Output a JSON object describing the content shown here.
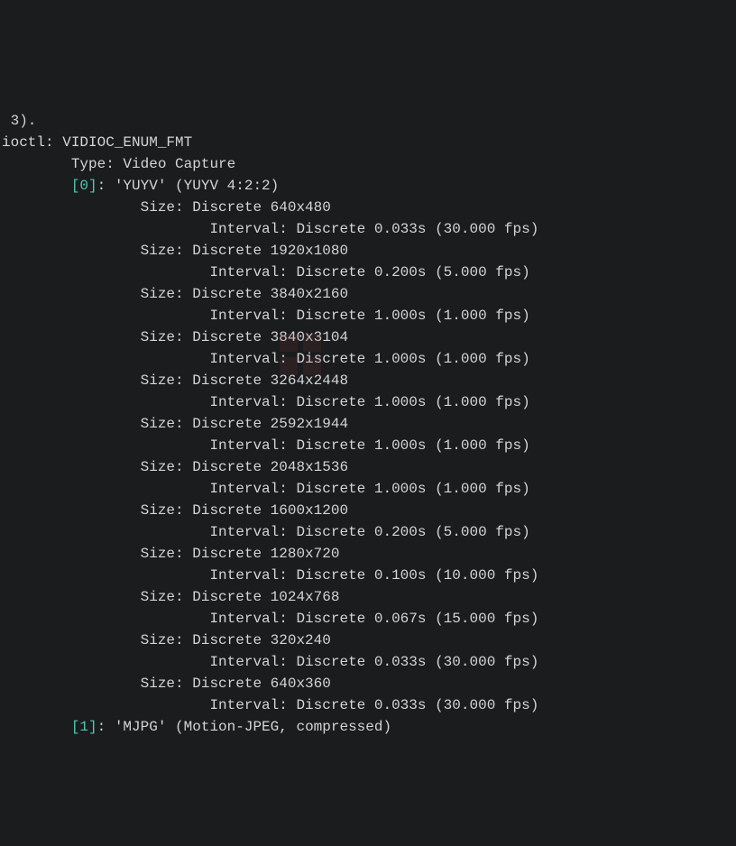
{
  "lines": [
    {
      "indent": 0,
      "segments": [
        {
          "text": " 3).",
          "cls": "white"
        }
      ]
    },
    {
      "indent": 0,
      "segments": [
        {
          "text": "ioctl: VIDIOC_ENUM_FMT",
          "cls": "white"
        }
      ]
    },
    {
      "indent": 8,
      "segments": [
        {
          "text": "Type: Video Capture",
          "cls": "white"
        }
      ]
    },
    {
      "indent": 0,
      "segments": [
        {
          "text": "",
          "cls": "white"
        }
      ]
    },
    {
      "indent": 8,
      "segments": [
        {
          "text": "[0]",
          "cls": "cyan"
        },
        {
          "text": ": 'YUYV' (YUYV 4:2:2)",
          "cls": "white"
        }
      ]
    },
    {
      "indent": 16,
      "segments": [
        {
          "text": "Size: Discrete 640x480",
          "cls": "white"
        }
      ]
    },
    {
      "indent": 24,
      "segments": [
        {
          "text": "Interval: Discrete 0.033s (30.000 fps)",
          "cls": "white"
        }
      ]
    },
    {
      "indent": 16,
      "segments": [
        {
          "text": "Size: Discrete 1920x1080",
          "cls": "white"
        }
      ]
    },
    {
      "indent": 24,
      "segments": [
        {
          "text": "Interval: Discrete 0.200s (5.000 fps)",
          "cls": "white"
        }
      ]
    },
    {
      "indent": 16,
      "segments": [
        {
          "text": "Size: Discrete 3840x2160",
          "cls": "white"
        }
      ]
    },
    {
      "indent": 24,
      "segments": [
        {
          "text": "Interval: Discrete 1.000s (1.000 fps)",
          "cls": "white"
        }
      ]
    },
    {
      "indent": 16,
      "segments": [
        {
          "text": "Size: Discrete 3840x3104",
          "cls": "white"
        }
      ]
    },
    {
      "indent": 24,
      "segments": [
        {
          "text": "Interval: Discrete 1.000s (1.000 fps)",
          "cls": "white"
        }
      ]
    },
    {
      "indent": 16,
      "segments": [
        {
          "text": "Size: Discrete 3264x2448",
          "cls": "white"
        }
      ]
    },
    {
      "indent": 24,
      "segments": [
        {
          "text": "Interval: Discrete 1.000s (1.000 fps)",
          "cls": "white"
        }
      ]
    },
    {
      "indent": 16,
      "segments": [
        {
          "text": "Size: Discrete 2592x1944",
          "cls": "white"
        }
      ]
    },
    {
      "indent": 24,
      "segments": [
        {
          "text": "Interval: Discrete 1.000s (1.000 fps)",
          "cls": "white"
        }
      ]
    },
    {
      "indent": 16,
      "segments": [
        {
          "text": "Size: Discrete 2048x1536",
          "cls": "white"
        }
      ]
    },
    {
      "indent": 24,
      "segments": [
        {
          "text": "Interval: Discrete 1.000s (1.000 fps)",
          "cls": "white"
        }
      ]
    },
    {
      "indent": 16,
      "segments": [
        {
          "text": "Size: Discrete 1600x1200",
          "cls": "white"
        }
      ]
    },
    {
      "indent": 24,
      "segments": [
        {
          "text": "Interval: Discrete 0.200s (5.000 fps)",
          "cls": "white"
        }
      ]
    },
    {
      "indent": 16,
      "segments": [
        {
          "text": "Size: Discrete 1280x720",
          "cls": "white"
        }
      ]
    },
    {
      "indent": 24,
      "segments": [
        {
          "text": "Interval: Discrete 0.100s (10.000 fps)",
          "cls": "white"
        }
      ]
    },
    {
      "indent": 16,
      "segments": [
        {
          "text": "Size: Discrete 1024x768",
          "cls": "white"
        }
      ]
    },
    {
      "indent": 24,
      "segments": [
        {
          "text": "Interval: Discrete 0.067s (15.000 fps)",
          "cls": "white"
        }
      ]
    },
    {
      "indent": 16,
      "segments": [
        {
          "text": "Size: Discrete 320x240",
          "cls": "white"
        }
      ]
    },
    {
      "indent": 24,
      "segments": [
        {
          "text": "Interval: Discrete 0.033s (30.000 fps)",
          "cls": "white"
        }
      ]
    },
    {
      "indent": 16,
      "segments": [
        {
          "text": "Size: Discrete 640x360",
          "cls": "white"
        }
      ]
    },
    {
      "indent": 24,
      "segments": [
        {
          "text": "Interval: Discrete 0.033s (30.000 fps)",
          "cls": "white"
        }
      ]
    },
    {
      "indent": 8,
      "segments": [
        {
          "text": "[1]",
          "cls": "cyan"
        },
        {
          "text": ": 'MJPG' (Motion-JPEG, compressed)",
          "cls": "white"
        }
      ]
    }
  ]
}
